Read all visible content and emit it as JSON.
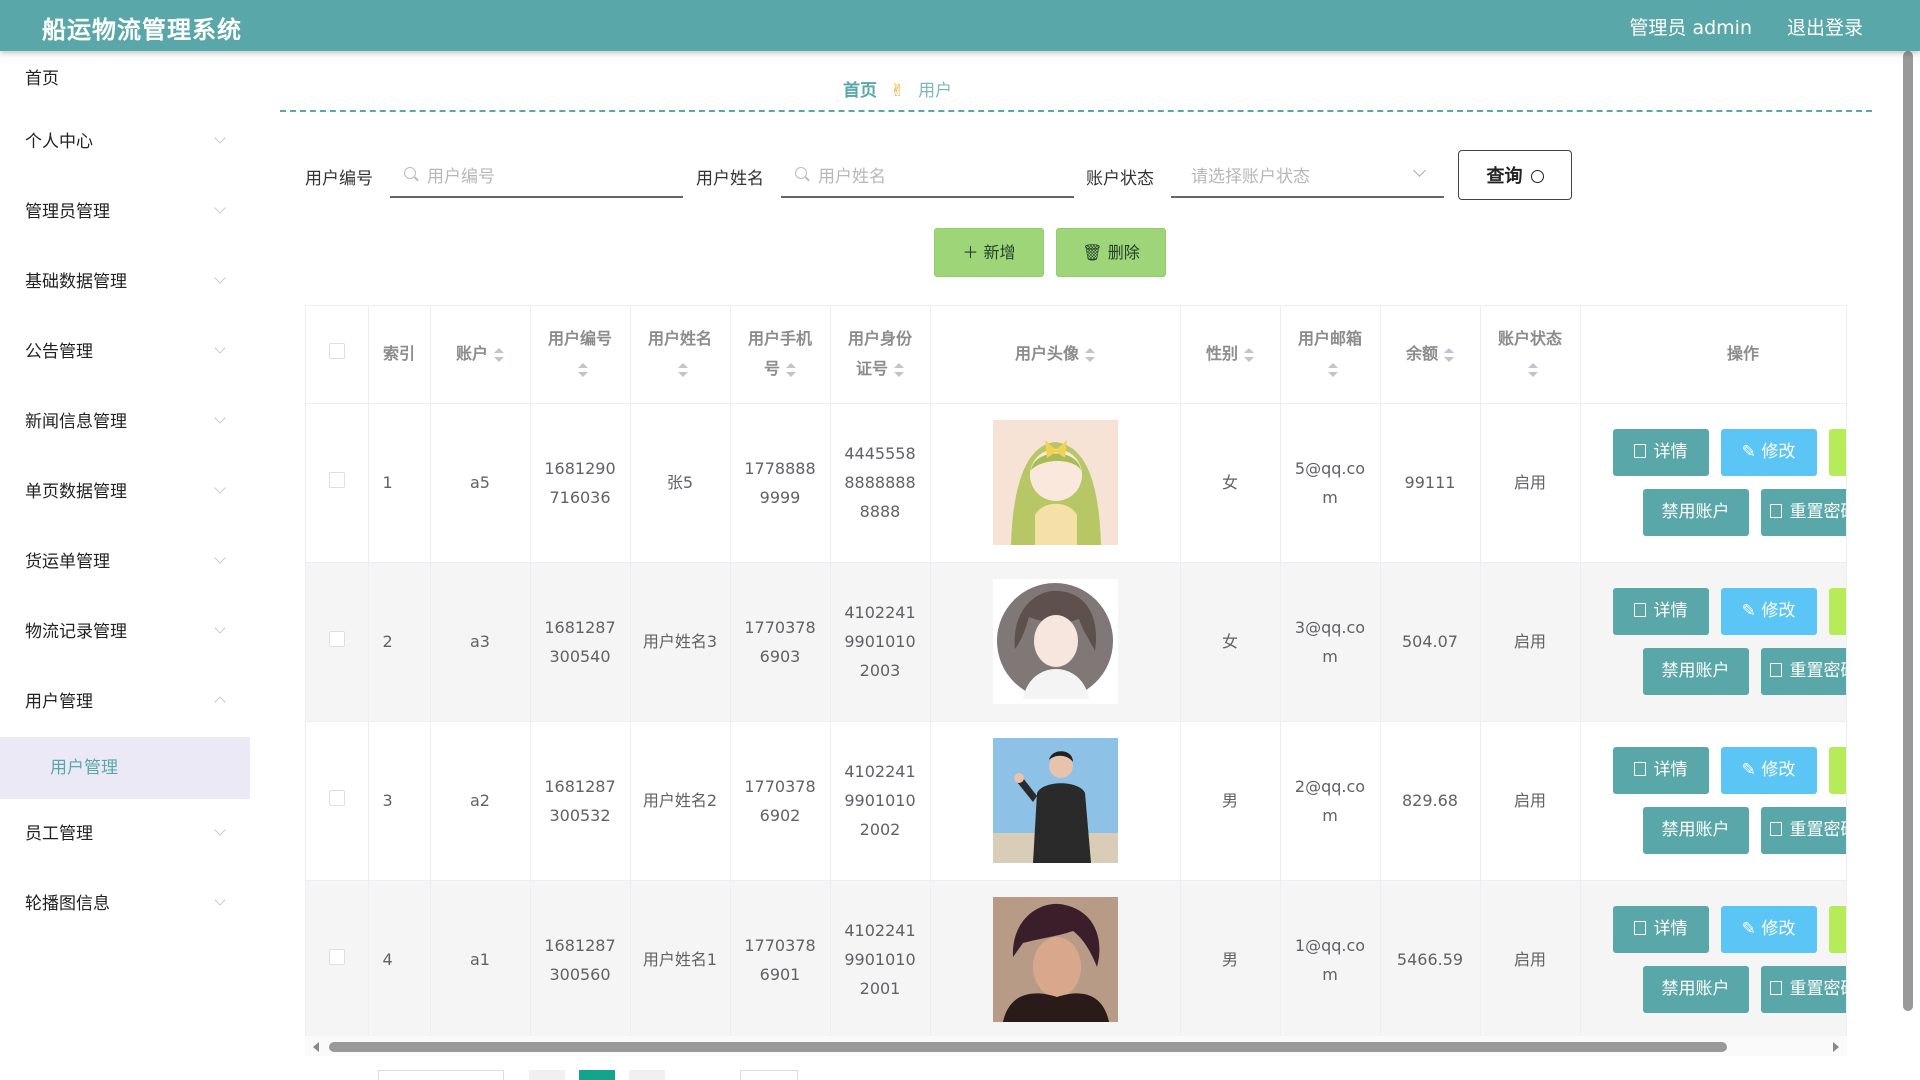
{
  "header": {
    "title": "船运物流管理系统",
    "user": "管理员 admin",
    "logout": "退出登录",
    "color": "#5aa7a9"
  },
  "sidebar": {
    "items": [
      {
        "label": "首页"
      },
      {
        "label": "个人中心"
      },
      {
        "label": "管理员管理"
      },
      {
        "label": "基础数据管理"
      },
      {
        "label": "公告管理"
      },
      {
        "label": "新闻信息管理"
      },
      {
        "label": "单页数据管理"
      },
      {
        "label": "货运单管理"
      },
      {
        "label": "物流记录管理"
      },
      {
        "label": "用户管理"
      },
      {
        "label": "员工管理"
      },
      {
        "label": "轮播图信息"
      }
    ],
    "sub_item": "用户管理"
  },
  "breadcrumb": {
    "home": "首页",
    "current": "用户"
  },
  "search": {
    "user_no_label": "用户编号",
    "user_no_placeholder": "用户编号",
    "user_name_label": "用户姓名",
    "user_name_placeholder": "用户姓名",
    "status_label": "账户状态",
    "status_placeholder": "请选择账户状态",
    "query_label": "查询"
  },
  "actions": {
    "add": "新增",
    "delete": "删除"
  },
  "table": {
    "columns": {
      "index": "索引",
      "account": "账户",
      "user_no": "用户编号",
      "user_name": "用户姓名",
      "phone": "用户手机号",
      "id_card": "用户身份证号",
      "avatar": "用户头像",
      "gender": "性别",
      "email": "用户邮箱",
      "balance": "余额",
      "status": "账户状态",
      "ops": "操作"
    },
    "rows": [
      {
        "index": "1",
        "account": "a5",
        "user_no": "1681290716036",
        "user_name": "张5",
        "phone": "17788889999",
        "id_card": "444555888888888888",
        "gender": "女",
        "email": "5@qq.com",
        "balance": "99111",
        "status": "启用"
      },
      {
        "index": "2",
        "account": "a3",
        "user_no": "1681287300540",
        "user_name": "用户姓名3",
        "phone": "17703786903",
        "id_card": "410224199010102003",
        "gender": "女",
        "email": "3@qq.com",
        "balance": "504.07",
        "status": "启用"
      },
      {
        "index": "3",
        "account": "a2",
        "user_no": "1681287300532",
        "user_name": "用户姓名2",
        "phone": "17703786902",
        "id_card": "410224199010102002",
        "gender": "男",
        "email": "2@qq.com",
        "balance": "829.68",
        "status": "启用"
      },
      {
        "index": "4",
        "account": "a1",
        "user_no": "1681287300560",
        "user_name": "用户姓名1",
        "phone": "17703786901",
        "id_card": "410224199010102001",
        "gender": "男",
        "email": "1@qq.com",
        "balance": "5466.59",
        "status": "启用"
      }
    ],
    "op_labels": {
      "detail": "详情",
      "edit": "修改",
      "disable": "禁用账户",
      "reset": "重置密码"
    }
  }
}
